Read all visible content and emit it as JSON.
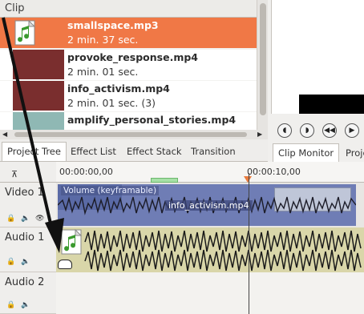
{
  "clip_panel": {
    "title": "Clip",
    "clips": [
      {
        "name": "smallspace.mp3",
        "duration": "2 min. 37 sec.",
        "type": "audio",
        "selected": true
      },
      {
        "name": "provoke_response.mp4",
        "duration": "2 min. 01 sec.",
        "type": "video",
        "selected": false
      },
      {
        "name": "info_activism.mp4",
        "duration": "2 min. 01 sec. (3)",
        "type": "video",
        "selected": false
      },
      {
        "name": "amplify_personal_stories.mp4",
        "duration": "",
        "type": "video",
        "selected": false
      }
    ]
  },
  "tabs": {
    "project_tree": "Project Tree",
    "effect_list": "Effect List",
    "effect_stack": "Effect Stack",
    "transition": "Transition"
  },
  "monitor_tabs": {
    "clip_monitor": "Clip Monitor",
    "project": "Proje"
  },
  "timeline": {
    "ruler": {
      "start": "00:00:00,00",
      "mark": "00:00:10,00"
    },
    "tracks": {
      "video1": "Video 1",
      "audio1": "Audio 1",
      "audio2": "Audio 2"
    },
    "video_clip": {
      "volume_label": "Volume (keyframable)",
      "name": "info_activism.mp4"
    }
  },
  "colors": {
    "selection": "#f07846",
    "video_thumb": "#7a2e2e",
    "video_clip": "#6f7db5",
    "audio_track": "#d9d6a9"
  }
}
